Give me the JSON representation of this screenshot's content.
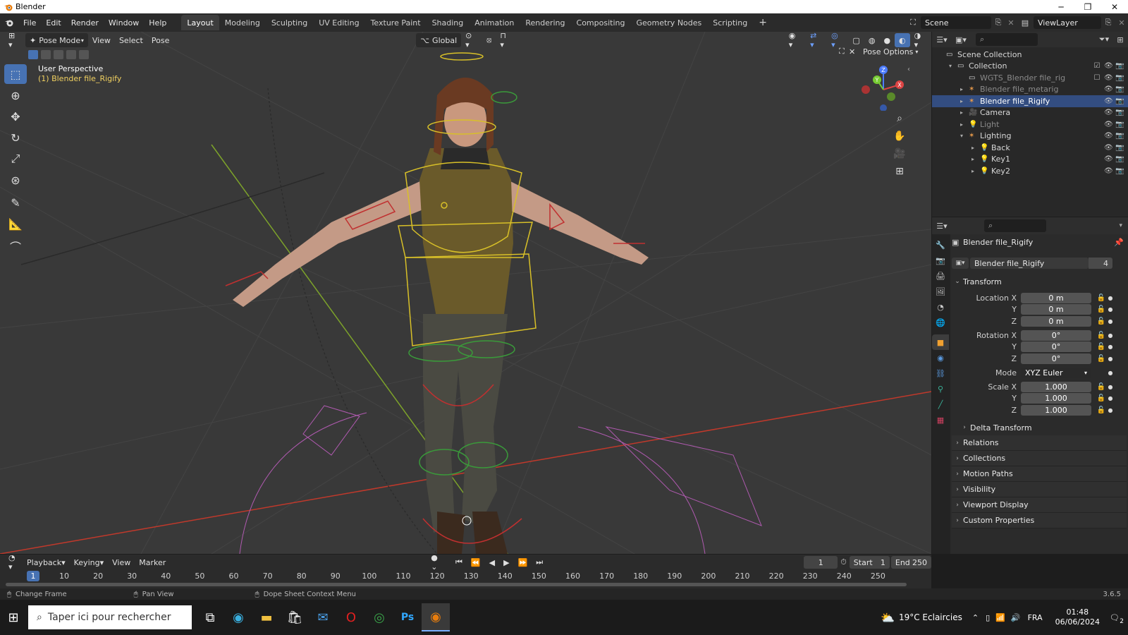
{
  "window": {
    "title": "Blender",
    "minimize": "─",
    "maximize": "❐",
    "close": "✕"
  },
  "menu": [
    "File",
    "Edit",
    "Render",
    "Window",
    "Help"
  ],
  "workspaces": [
    "Layout",
    "Modeling",
    "Sculpting",
    "UV Editing",
    "Texture Paint",
    "Shading",
    "Animation",
    "Rendering",
    "Compositing",
    "Geometry Nodes",
    "Scripting"
  ],
  "active_workspace": "Layout",
  "add_workspace": "+",
  "scene": {
    "label": "Scene",
    "view_layer": "ViewLayer"
  },
  "viewport": {
    "mode": "Pose Mode",
    "menus": [
      "View",
      "Select",
      "Pose"
    ],
    "orientation": "Global",
    "pose_options": "Pose Options",
    "perspective": "User Perspective",
    "object_label": "(1) Blender file_Rigify",
    "axis_x": "X",
    "axis_y": "Y",
    "axis_z": "Z"
  },
  "outliner": {
    "rows": [
      {
        "label": "Scene Collection",
        "indent": 0,
        "icon": "collection"
      },
      {
        "label": "Collection",
        "indent": 1,
        "icon": "collection"
      },
      {
        "label": "WGTS_Blender file_rig",
        "indent": 2,
        "icon": "collection",
        "dim": true
      },
      {
        "label": "Blender file_metarig",
        "indent": 2,
        "icon": "armature",
        "dim": true
      },
      {
        "label": "Blender file_Rigify",
        "indent": 2,
        "icon": "armature",
        "selected": true
      },
      {
        "label": "Camera",
        "indent": 2,
        "icon": "camera"
      },
      {
        "label": "Light",
        "indent": 2,
        "icon": "light",
        "dim": true
      },
      {
        "label": "Lighting",
        "indent": 2,
        "icon": "armature"
      },
      {
        "label": "Back",
        "indent": 3,
        "icon": "light"
      },
      {
        "label": "Key1",
        "indent": 3,
        "icon": "light"
      },
      {
        "label": "Key2",
        "indent": 3,
        "icon": "light"
      }
    ]
  },
  "properties": {
    "object_name": "Blender file_Rigify",
    "datablock_name": "Blender file_Rigify",
    "users": "4",
    "transform_title": "Transform",
    "location": {
      "label": "Location X",
      "x": "0 m",
      "y": "0 m",
      "z": "0 m"
    },
    "rotation": {
      "label": "Rotation X",
      "x": "0°",
      "y": "0°",
      "z": "0°"
    },
    "mode_label": "Mode",
    "mode_value": "XYZ Euler",
    "scale": {
      "label": "Scale X",
      "x": "1.000",
      "y": "1.000",
      "z": "1.000"
    },
    "y_label": "Y",
    "z_label": "Z",
    "delta": "Delta Transform",
    "panels": [
      "Relations",
      "Collections",
      "Motion Paths",
      "Visibility",
      "Viewport Display",
      "Custom Properties"
    ]
  },
  "timeline": {
    "menus": [
      "Playback",
      "Keying",
      "View",
      "Marker"
    ],
    "current_frame": "1",
    "start_label": "Start",
    "start": "1",
    "end_label": "End",
    "end": "250",
    "ticks": [
      "10",
      "20",
      "30",
      "40",
      "50",
      "60",
      "70",
      "80",
      "90",
      "100",
      "110",
      "120",
      "130",
      "140",
      "150",
      "160",
      "170",
      "180",
      "190",
      "200",
      "210",
      "220",
      "230",
      "240",
      "250"
    ],
    "cursor": "1"
  },
  "statusbar": {
    "left": "Change Frame",
    "mid": "Pan View",
    "right": "Dope Sheet Context Menu",
    "version": "3.6.5"
  },
  "taskbar": {
    "search_placeholder": "Taper ici pour rechercher",
    "weather": "19°C  Eclaircies",
    "lang": "FRA",
    "time": "01:48",
    "date": "06/06/2024",
    "notif": "2"
  }
}
